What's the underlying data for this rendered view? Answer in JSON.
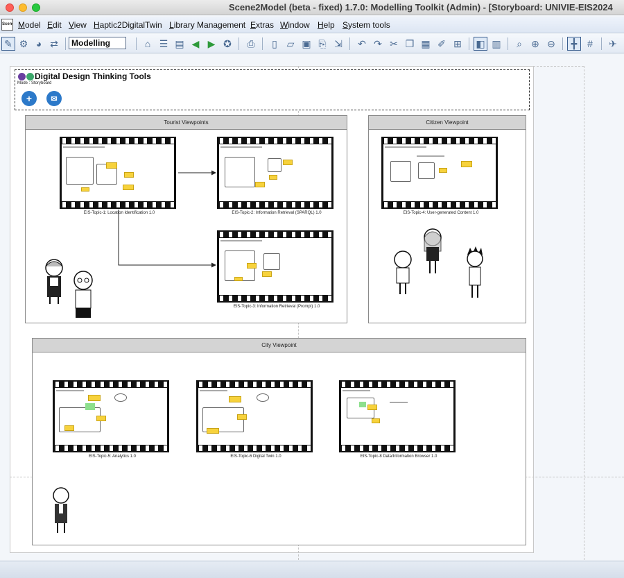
{
  "window": {
    "title": "Scene2Model (beta - fixed) 1.7.0: Modelling Toolkit (Admin) - [Storyboard: UNIVIE-EIS2024"
  },
  "menu": {
    "app_icon": "Scene",
    "items": [
      "Model",
      "Edit",
      "View",
      "Haptic2DigitalTwin",
      "Library Management",
      "Extras",
      "Window",
      "Help",
      "System tools"
    ]
  },
  "toolbar": {
    "mode_value": "Modelling",
    "icons": [
      "edit-icon",
      "object-icon",
      "palette-icon",
      "home-icon",
      "database-icon",
      "library-icon",
      "back-green-icon",
      "forward-green-icon",
      "compass-icon",
      "export-icon",
      "new-file-icon",
      "open-folder-icon",
      "save-icon",
      "print-icon",
      "import-icon",
      "undo-icon",
      "redo-icon",
      "cut-icon",
      "copy-icon",
      "paste-icon",
      "brush-icon",
      "grid-tool-icon",
      "layout-icon",
      "table-icon",
      "zoom-icon",
      "zoom-in-icon",
      "zoom-out-icon",
      "align-icon",
      "grid-icon",
      "pin-icon"
    ]
  },
  "header": {
    "title": "Digital Design Thinking Tools",
    "mode": "Mode : Storyboard",
    "add_symbol": "+",
    "mail_symbol": "✉"
  },
  "viewpoints": {
    "tourist": {
      "title": "Tourist Viewpoints"
    },
    "citizen": {
      "title": "Citizen Viewpoint"
    },
    "city": {
      "title": "City Viewpoint"
    }
  },
  "scenes": [
    {
      "caption": "EIS-Topic-1: Location Identification 1.0"
    },
    {
      "caption": "EIS-Topic-2: Information Retrieval (SPARQL) 1.0"
    },
    {
      "caption": "EIS-Topic-3: Information Retrieval (Prompt) 1.0"
    },
    {
      "caption": "EIS-Topic-4: User-generated Content 1.0"
    },
    {
      "caption": "EIS-Topic-5: Analytics 1.0"
    },
    {
      "caption": "EIS-Topic-6 Digital Twin 1.0"
    },
    {
      "caption": "EIS-Topic-8 Data/Information Browser 1.0"
    }
  ],
  "colors": {
    "note_yellow": "#f7d23c",
    "header_button_blue": "#2c79c9",
    "viewpoint_header_gray": "#d4d4d4"
  }
}
